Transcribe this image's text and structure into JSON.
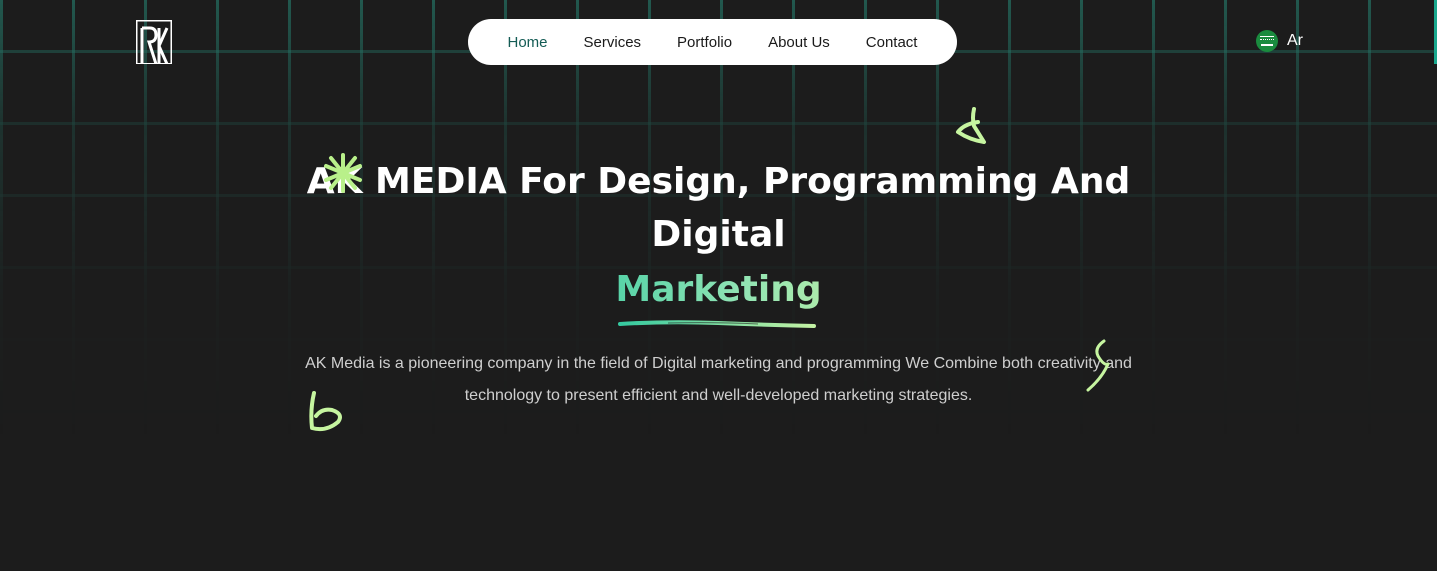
{
  "brand": {
    "logo_text": "RK"
  },
  "nav": {
    "items": [
      {
        "label": "Home",
        "active": true
      },
      {
        "label": "Services",
        "active": false
      },
      {
        "label": "Portfolio",
        "active": false
      },
      {
        "label": "About Us",
        "active": false
      },
      {
        "label": "Contact",
        "active": false
      }
    ]
  },
  "language": {
    "label": "Ar",
    "flag_icon": "saudi-flag-icon"
  },
  "hero": {
    "title": "AK MEDIA For Design, Programming And Digital",
    "highlight": "Marketing",
    "description": "AK Media is a pioneering company in the field of Digital marketing and programming We Combine both creativity and technology to present efficient and well-developed marketing strategies."
  },
  "colors": {
    "background": "#1c1c1c",
    "accent": "#1aa88e",
    "nav_active": "#145c55",
    "doodle": "#c6f5a0",
    "gradient_start": "#35c9a0",
    "gradient_end": "#c4f2a4"
  }
}
